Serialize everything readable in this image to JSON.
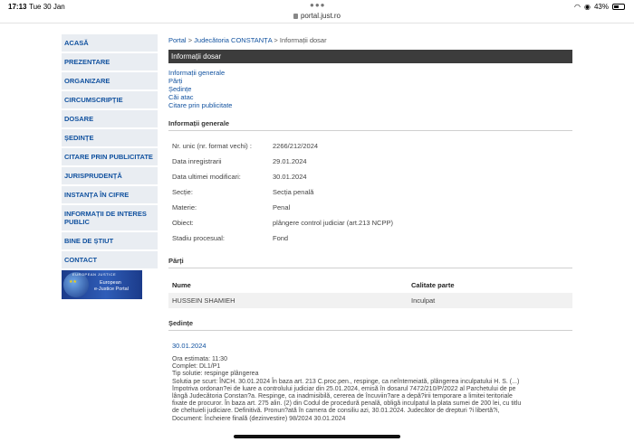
{
  "status": {
    "time": "17:13",
    "date": "Tue 30 Jan",
    "battery": "43%",
    "url": "portal.just.ro"
  },
  "sidebar": {
    "items": [
      {
        "label": "ACASĂ"
      },
      {
        "label": "PREZENTARE"
      },
      {
        "label": "ORGANIZARE"
      },
      {
        "label": "CIRCUMSCRIPȚIE"
      },
      {
        "label": "DOSARE"
      },
      {
        "label": "ȘEDINȚE"
      },
      {
        "label": "CITARE PRIN PUBLICITATE"
      },
      {
        "label": "JURISPRUDENȚĂ"
      },
      {
        "label": "INSTANȚA ÎN CIFRE"
      },
      {
        "label": "INFORMAȚII DE INTERES PUBLIC"
      },
      {
        "label": "BINE DE ȘTIUT"
      },
      {
        "label": "CONTACT"
      }
    ],
    "logo": {
      "top": "EUROPEAN JUSTICE",
      "line1": "European",
      "line2": "e-Justice Portal"
    }
  },
  "breadcrumb": {
    "portal": "Portal",
    "court": "Judecătoria CONSTANȚA",
    "current": "Informații dosar",
    "sep": ">"
  },
  "page_title": "Informații dosar",
  "links": [
    "Informații generale",
    "Părți",
    "Ședințe",
    "Căi atac",
    "Citare prin publicitate"
  ],
  "general": {
    "title": "Informații generale",
    "rows": [
      {
        "key": "Nr. unic (nr. format vechi) :",
        "value": "2266/212/2024"
      },
      {
        "key": "Data inregistrarii",
        "value": "29.01.2024"
      },
      {
        "key": "Data ultimei modificari:",
        "value": "30.01.2024"
      },
      {
        "key": "Secție:",
        "value": "Secția penală"
      },
      {
        "key": "Materie:",
        "value": "Penal"
      },
      {
        "key": "Obiect:",
        "value": "plângere control judiciar (art.213 NCPP)"
      },
      {
        "key": "Stadiu procesual:",
        "value": "Fond"
      }
    ]
  },
  "parti": {
    "title": "Părți",
    "col_name": "Nume",
    "col_role": "Calitate parte",
    "rows": [
      {
        "name": "HUSSEIN SHAMIEH",
        "role": "Inculpat"
      }
    ]
  },
  "sedinte": {
    "title": "Ședințe",
    "date": "30.01.2024",
    "lines": [
      "Ora estimata: 11:30",
      "Complet: DL1/P1",
      "Tip solutie: respinge plângerea",
      "Solutia pe scurt: ÎNCH. 30.01.2024 În baza art. 213 C.proc.pen., respinge, ca neîntemeiată, plângerea inculpatului H. S. (...)",
      "împotriva ordonan?ei de luare a controlului judiciar din 25.01.2024, emisă în dosarul 7472/210/P/2022 al Parchetului de pe",
      "lângă Judecătoria Constan?a. Respinge, ca inadmisibilă, cererea de încuviin?are a depă?irii temporare a limitei teritoriale",
      "fixate de procuror. În baza art. 275 alin. (2) din Codul de procedură penală, obligă inculpatul la plata sumei de 200 lei, cu titlu",
      "de cheltuieli judiciare. Definitivă. Pronun?ată în camera de consiliu azi, 30.01.2024. Judecător de drepturi ?i libertă?i,",
      "Document: Încheiere finală (dezinvestire)  98/2024  30.01.2024"
    ]
  }
}
